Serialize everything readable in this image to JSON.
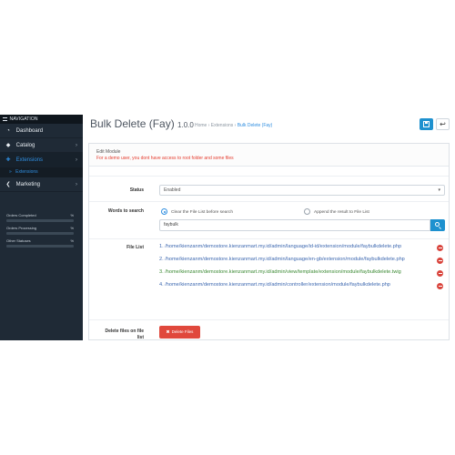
{
  "sidebar": {
    "heading": "NAVIGATION",
    "items": [
      {
        "label": "Dashboard",
        "icon": "dashboard-icon"
      },
      {
        "label": "Catalog",
        "icon": "tag-icon",
        "chevron": "›"
      },
      {
        "label": "Extensions",
        "icon": "puzzle-icon",
        "chevron": "›"
      },
      {
        "label": "Marketing",
        "icon": "share-icon",
        "chevron": "›"
      }
    ],
    "subitem": {
      "label": "Extensions"
    },
    "stats": [
      {
        "label": "Orders Completed",
        "value": "%"
      },
      {
        "label": "Orders Processing",
        "value": "%"
      },
      {
        "label": "Other Statuses",
        "value": "%"
      }
    ]
  },
  "header": {
    "title": "Bulk Delete (Fay)",
    "version": "1.0.0",
    "breadcrumb": [
      "Home",
      "Extensions",
      "Bulk Delete (Fay)"
    ],
    "breadcrumb_sep": "›",
    "back_glyph": "↩"
  },
  "panel": {
    "title": "Edit Module",
    "note": "For a demo user, you dont have access to root folder and some files"
  },
  "form": {
    "status_label": "Status",
    "status_value": "Enabled",
    "words_label": "Words to search",
    "radio_clear": "Clear the File List before search",
    "radio_append": "Append the result to File List",
    "search_value": "faybulk",
    "file_list_label": "File List",
    "files": [
      {
        "text": "1. /home/kienzanm/demostore.kienzanmart.my.id/admin/language/id-id/extension/module/faybulkdelete.php",
        "color": "blue"
      },
      {
        "text": "2. /home/kienzanm/demostore.kienzanmart.my.id/admin/language/en-gb/extension/module/faybulkdelete.php",
        "color": "blue"
      },
      {
        "text": "3. /home/kienzanm/demostore.kienzanmart.my.id/admin/view/template/extension/module/faybulkdelete.twig",
        "color": "green"
      },
      {
        "text": "4. /home/kienzanm/demostore.kienzanmart.my.id/admin/controller/extension/module/faybulkdelete.php",
        "color": "blue"
      }
    ],
    "delete_label": "Delete files on file list",
    "delete_button": "Delete Files",
    "delete_icon": "✖"
  },
  "colors": {
    "sidebar_bg": "#1f2a36",
    "accent": "#1e91cf",
    "danger": "#e0483c",
    "note_red": "#e53b2d"
  }
}
